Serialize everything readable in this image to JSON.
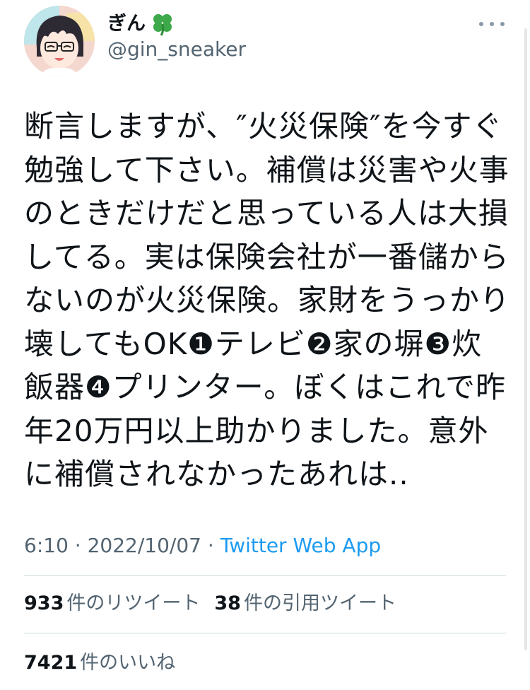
{
  "author": {
    "display_name": "ぎん",
    "emoji_icon": "four-leaf-clover-icon",
    "handle": "@gin_sneaker"
  },
  "tweet": {
    "text": "断言しますが、″火災保険″を今すぐ勉強して下さい。補償は災害や火事のときだけだと思っている人は大損してる。実は保険会社が一番儲からないのが火災保険。家財をうっかり壊してもOK❶テレビ❷家の塀❸炊飯器❹プリンター。ぼくはこれで昨年20万円以上助かりました。意外に補償されなかったあれは..",
    "time": "6:10",
    "separator": "·",
    "date": "2022/10/07",
    "source": "Twitter Web App"
  },
  "stats": {
    "retweets_count": "933",
    "retweets_label": "件のリツイート",
    "quotes_count": "38",
    "quotes_label": "件の引用ツイート",
    "likes_count": "7421",
    "likes_label": "件のいいね"
  },
  "colors": {
    "link": "#1d9bf0",
    "secondary_text": "#536471",
    "primary_text": "#0f1419"
  }
}
